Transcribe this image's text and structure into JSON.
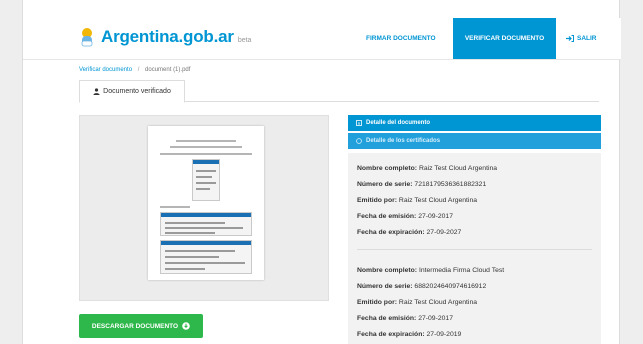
{
  "header": {
    "brand": "Argentina.gob.ar",
    "beta": "beta",
    "nav": [
      {
        "label": "FIRMAR DOCUMENTO"
      },
      {
        "label": "VERIFICAR DOCUMENTO"
      },
      {
        "label": "SALIR"
      }
    ]
  },
  "breadcrumb": {
    "link": "Verificar documento",
    "separator": "/",
    "current": "document (1).pdf"
  },
  "tabs": [
    {
      "label": "Documento verificado"
    }
  ],
  "download": {
    "label": "DESCARGAR DOCUMENTO"
  },
  "panel": {
    "detail_header": "Detalle del documento",
    "certs_header": "Detalle de los certificados",
    "certificates": [
      {
        "nombre_label": "Nombre completo:",
        "nombre": "Raiz Test Cloud Argentina",
        "serie_label": "Número de serie:",
        "serie": "7218179536361882321",
        "emitido_label": "Emitido por:",
        "emitido": "Raiz Test Cloud Argentina",
        "emision_label": "Fecha de emisión:",
        "emision": "27-09-2017",
        "expiracion_label": "Fecha de expiración:",
        "expiracion": "27-09-2027"
      },
      {
        "nombre_label": "Nombre completo:",
        "nombre": "Intermedia Firma Cloud Test",
        "serie_label": "Número de serie:",
        "serie": "6882024640974616912",
        "emitido_label": "Emitido por:",
        "emitido": "Raiz Test Cloud Argentina",
        "emision_label": "Fecha de emisión:",
        "emision": "27-09-2017",
        "expiracion_label": "Fecha de expiración:",
        "expiracion": "27-09-2019"
      }
    ]
  },
  "colors": {
    "primary": "#0095d3",
    "download": "#2eb84b",
    "panel_body": "#f2f2f2"
  },
  "icons": [
    "argentina-emblem-icon",
    "logout-icon",
    "user-icon",
    "info-icon",
    "certificate-icon",
    "download-icon"
  ]
}
